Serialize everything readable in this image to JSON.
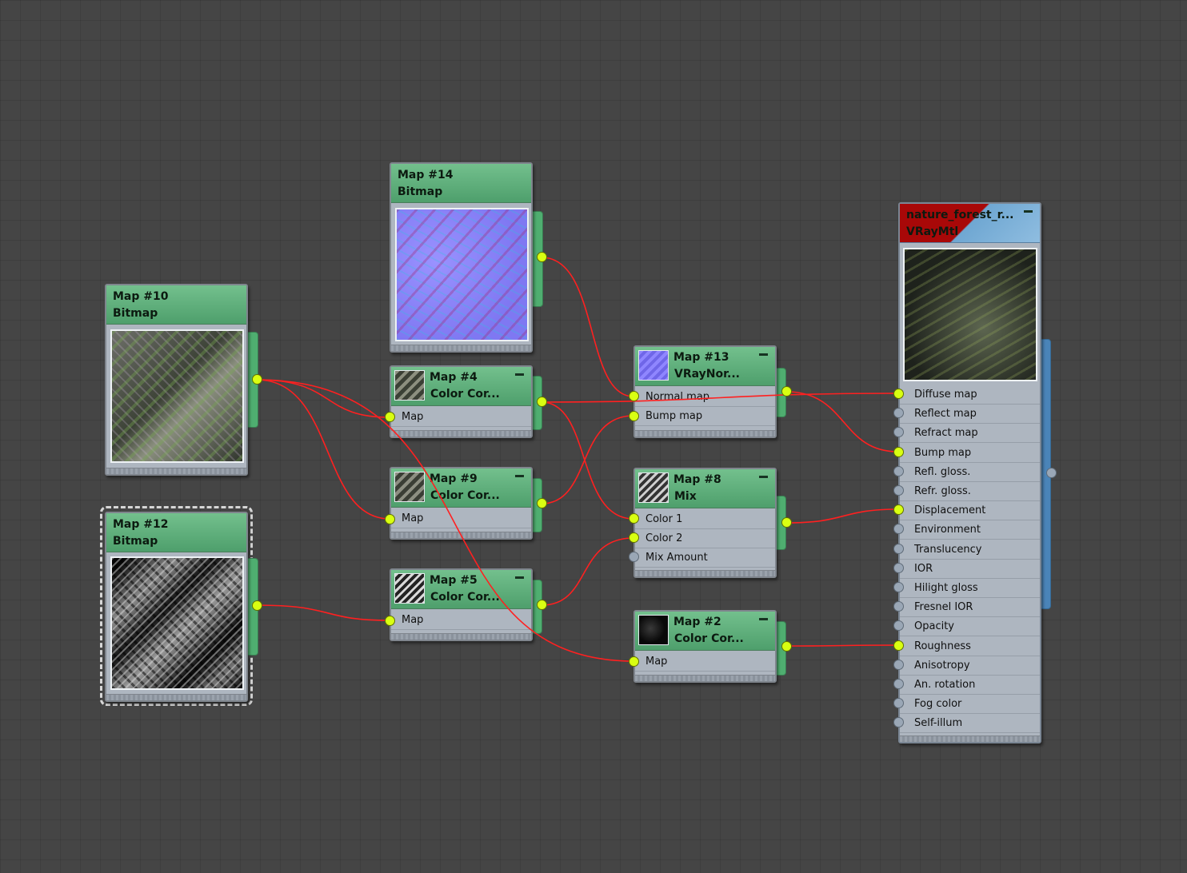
{
  "nodes": {
    "map14": {
      "name": "Map #14",
      "type": "Bitmap"
    },
    "map10": {
      "name": "Map #10",
      "type": "Bitmap"
    },
    "map12": {
      "name": "Map #12",
      "type": "Bitmap"
    },
    "map4": {
      "name": "Map #4",
      "type": "Color  Cor...",
      "input": "Map"
    },
    "map9": {
      "name": "Map #9",
      "type": "Color  Cor...",
      "input": "Map"
    },
    "map5": {
      "name": "Map #5",
      "type": "Color  Cor...",
      "input": "Map"
    },
    "map13": {
      "name": "Map #13",
      "type": "VRayNor...",
      "inputs": [
        "Normal map",
        "Bump map"
      ]
    },
    "map8": {
      "name": "Map #8",
      "type": "Mix",
      "inputs": [
        "Color 1",
        "Color 2",
        "Mix Amount"
      ]
    },
    "map2": {
      "name": "Map #2",
      "type": "Color  Cor...",
      "input": "Map"
    },
    "material": {
      "name": "nature_forest_r...",
      "type": "VRayMtl",
      "slots": [
        "Diffuse map",
        "Reflect map",
        "Refract map",
        "Bump map",
        "Refl. gloss.",
        "Refr. gloss.",
        "Displacement",
        "Environment",
        "Translucency",
        "IOR",
        "Hilight gloss",
        "Fresnel IOR",
        "Opacity",
        "Roughness",
        "Anisotropy",
        "An. rotation",
        "Fog color",
        "Self-illum"
      ],
      "connected_slots": [
        "Diffuse map",
        "Bump map",
        "Displacement",
        "Roughness"
      ]
    }
  },
  "colors": {
    "wire": "#ff2222",
    "socket_connected": "#d9ff12",
    "socket_empty": "#9aa7b6",
    "node_header": "#5fb07c",
    "material_header": "#a80808",
    "material_tab": "#4a84b8"
  }
}
